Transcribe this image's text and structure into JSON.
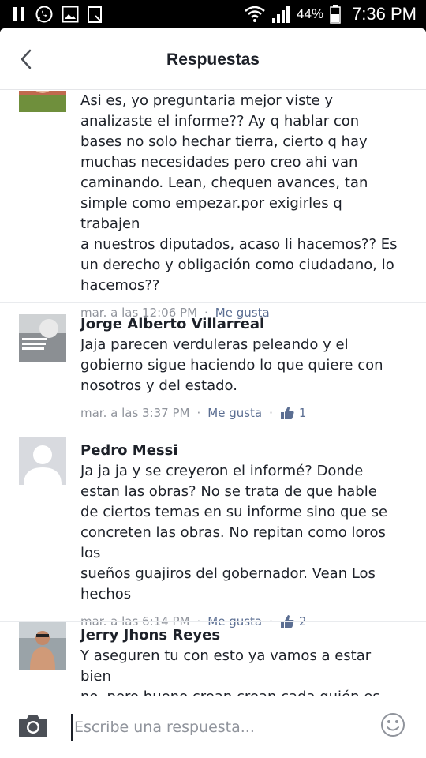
{
  "status_bar": {
    "battery": "44%",
    "time": "7:36 PM",
    "left_icons": [
      "pause-icon",
      "whatsapp-icon",
      "gallery-icon",
      "clipboard-icon"
    ],
    "right_icons": [
      "wifi-icon",
      "signal-icon",
      "battery-icon"
    ]
  },
  "header": {
    "title": "Respuestas",
    "back_icon": "chevron-left-icon"
  },
  "comments": [
    {
      "name": "",
      "text": "Asi es, yo preguntaria mejor viste y\nanalizaste el informe?? Ay q hablar con\nbases no solo hechar tierra, cierto q hay\nmuchas necesidades pero creo ahi van\ncaminando. Lean, chequen avances, tan\nsimple como empezar.por exigirles q trabajen\na nuestros diputados, acaso li hacemos?? Es\nun derecho y obligación  como ciudadano, lo\nhacemos??",
      "time": "mar. a las 12:06 PM",
      "like_label": "Me gusta",
      "likes": ""
    },
    {
      "name": "Jorge Alberto Villarreal",
      "text": "Jaja parecen verduleras peleando y el\ngobierno sigue haciendo lo que quiere con\nnosotros y del estado.",
      "time": "mar. a las 3:37 PM",
      "like_label": "Me gusta",
      "likes": "1"
    },
    {
      "name": "Pedro Messi",
      "text": "Ja ja ja y se creyeron el informé? Donde\nestan las obras?  No se trata de que hable\nde ciertos temas en su informe sino que se\nconcreten las obras. No repitan como loros los\nsueños guajiros del gobernador.  Vean Los\nhechos",
      "time": "mar. a las 6:14 PM",
      "like_label": "Me gusta",
      "likes": "2"
    },
    {
      "name": "Jerry Jhons Reyes",
      "text": "Y aseguren tu con esto ya vamos a estar bien\nno. pero bueno crean crean cada quién   es\nlibre de creer",
      "time": "",
      "like_label": "",
      "likes": ""
    }
  ],
  "composer": {
    "placeholder": "Escribe una respuesta...",
    "value": "",
    "camera_icon": "camera-icon",
    "emoji_icon": "smiley-icon"
  },
  "colors": {
    "text": "#1d2129",
    "meta": "#90949c",
    "link": "#5b6e92",
    "divider": "#e9ebee"
  }
}
